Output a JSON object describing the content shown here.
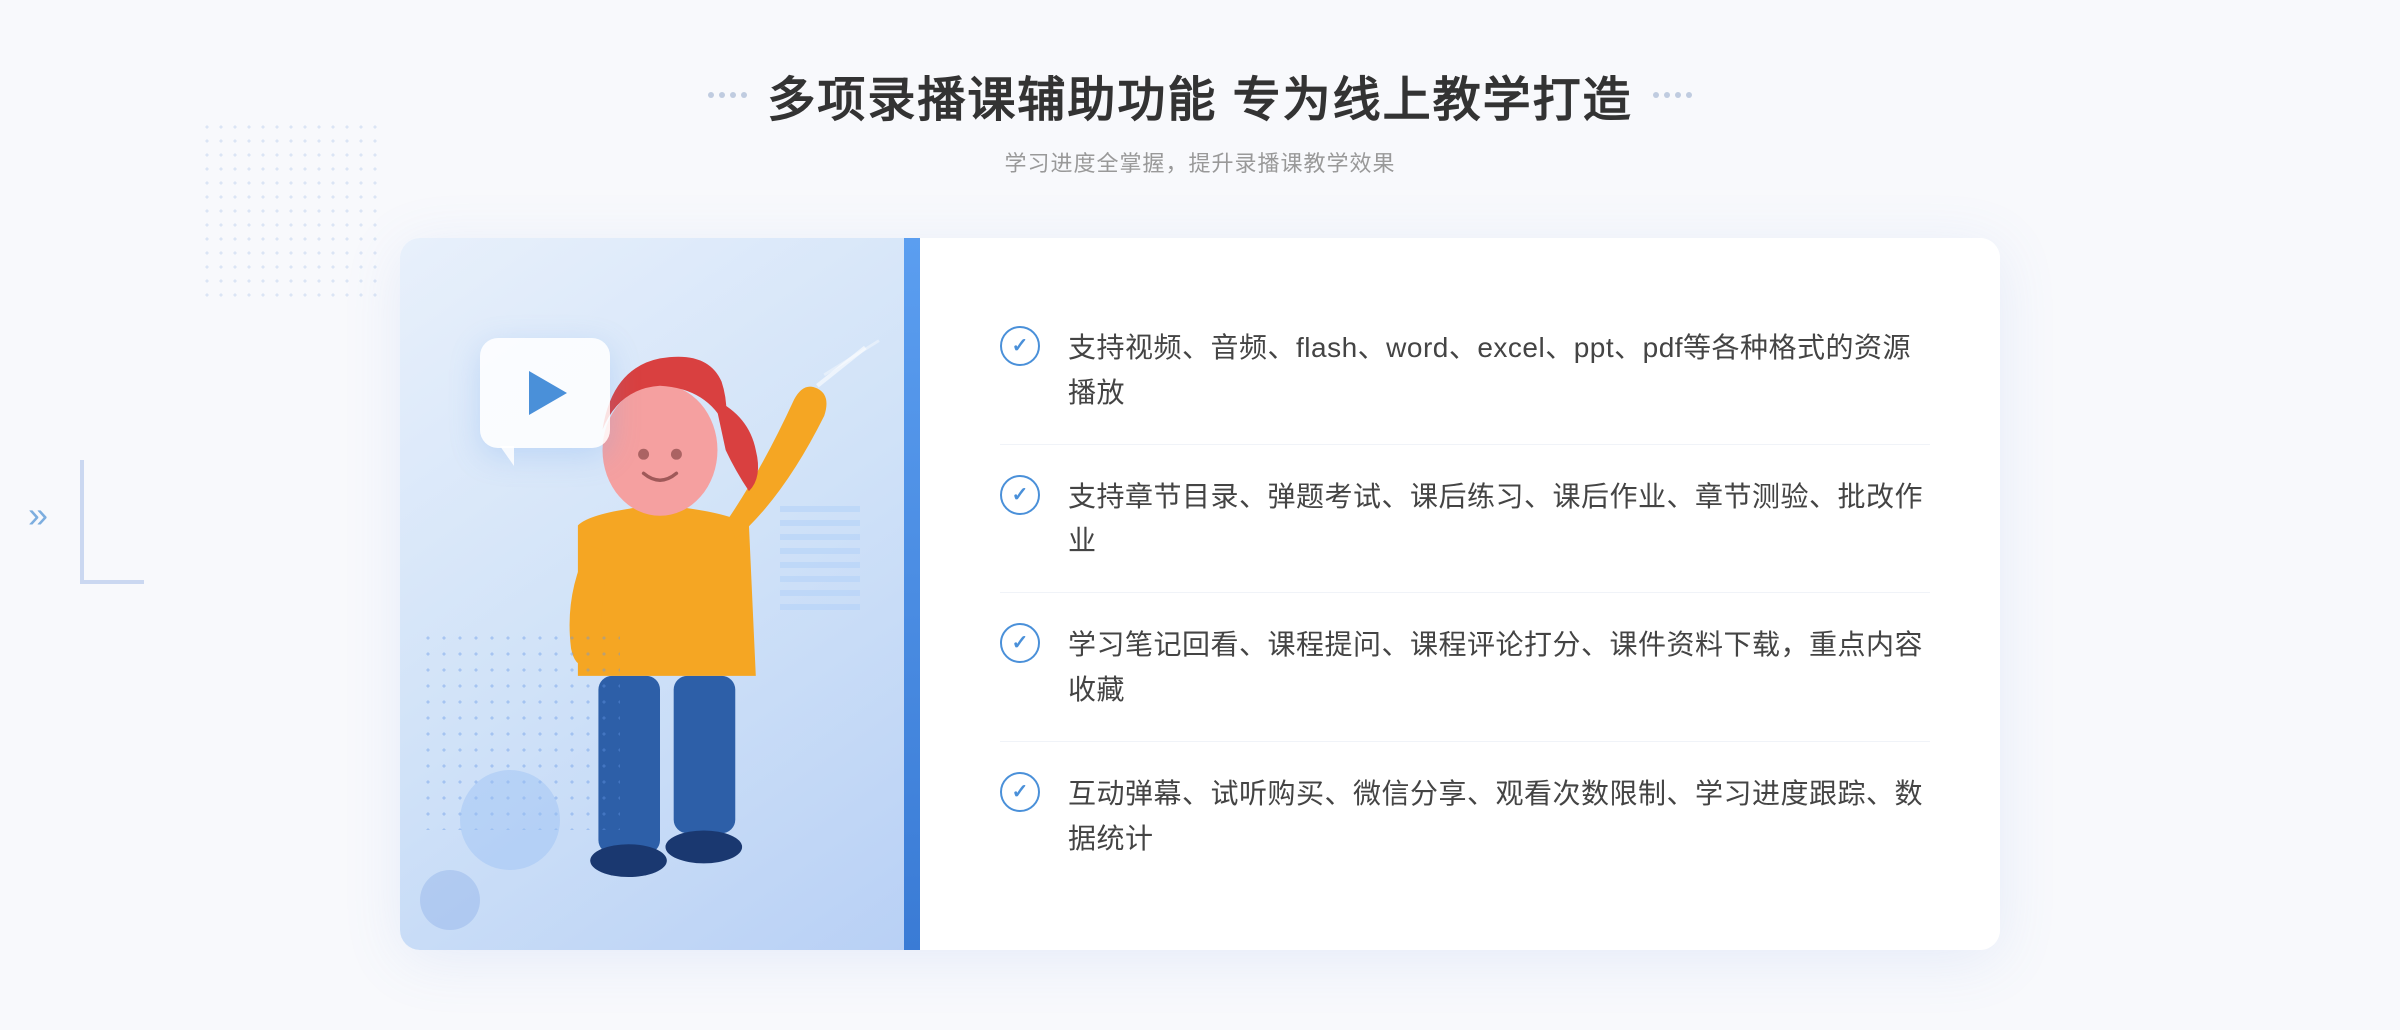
{
  "header": {
    "title": "多项录播课辅助功能 专为线上教学打造",
    "subtitle": "学习进度全掌握，提升录播课教学效果",
    "decorator_dots": 4
  },
  "features": [
    {
      "id": 1,
      "text": "支持视频、音频、flash、word、excel、ppt、pdf等各种格式的资源播放"
    },
    {
      "id": 2,
      "text": "支持章节目录、弹题考试、课后练习、课后作业、章节测验、批改作业"
    },
    {
      "id": 3,
      "text": "学习笔记回看、课程提问、课程评论打分、课件资料下载，重点内容收藏"
    },
    {
      "id": 4,
      "text": "互动弹幕、试听购买、微信分享、观看次数限制、学习进度跟踪、数据统计"
    }
  ],
  "colors": {
    "primary_blue": "#4a90d9",
    "light_blue": "#5b9ef0",
    "bg_light": "#f8f9fc",
    "text_dark": "#333",
    "text_medium": "#444",
    "text_light": "#999"
  }
}
